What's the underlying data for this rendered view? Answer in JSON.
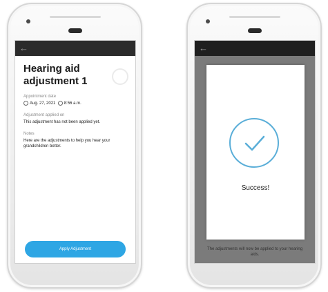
{
  "left_screen": {
    "back_icon": "←",
    "title": "Hearing aid adjustment 1",
    "appointment_label": "Appointment date",
    "appointment_date": "Aug. 27, 2021",
    "appointment_time": "8:56 a.m.",
    "applied_label": "Adjustment applied on",
    "applied_value": "This adjustment has not been applied yet.",
    "notes_label": "Notes",
    "notes_value": "Here are the adjustments to help you hear your grandchildren better.",
    "apply_button": "Apply Adjustment"
  },
  "right_screen": {
    "back_icon": "←",
    "background_text": "The adjustments will now be applied to your hearing aids.",
    "success_text": "Success!"
  },
  "colors": {
    "accent": "#2ea6e4",
    "success_ring": "#5aaed8",
    "topbar": "#2b2b2b"
  }
}
